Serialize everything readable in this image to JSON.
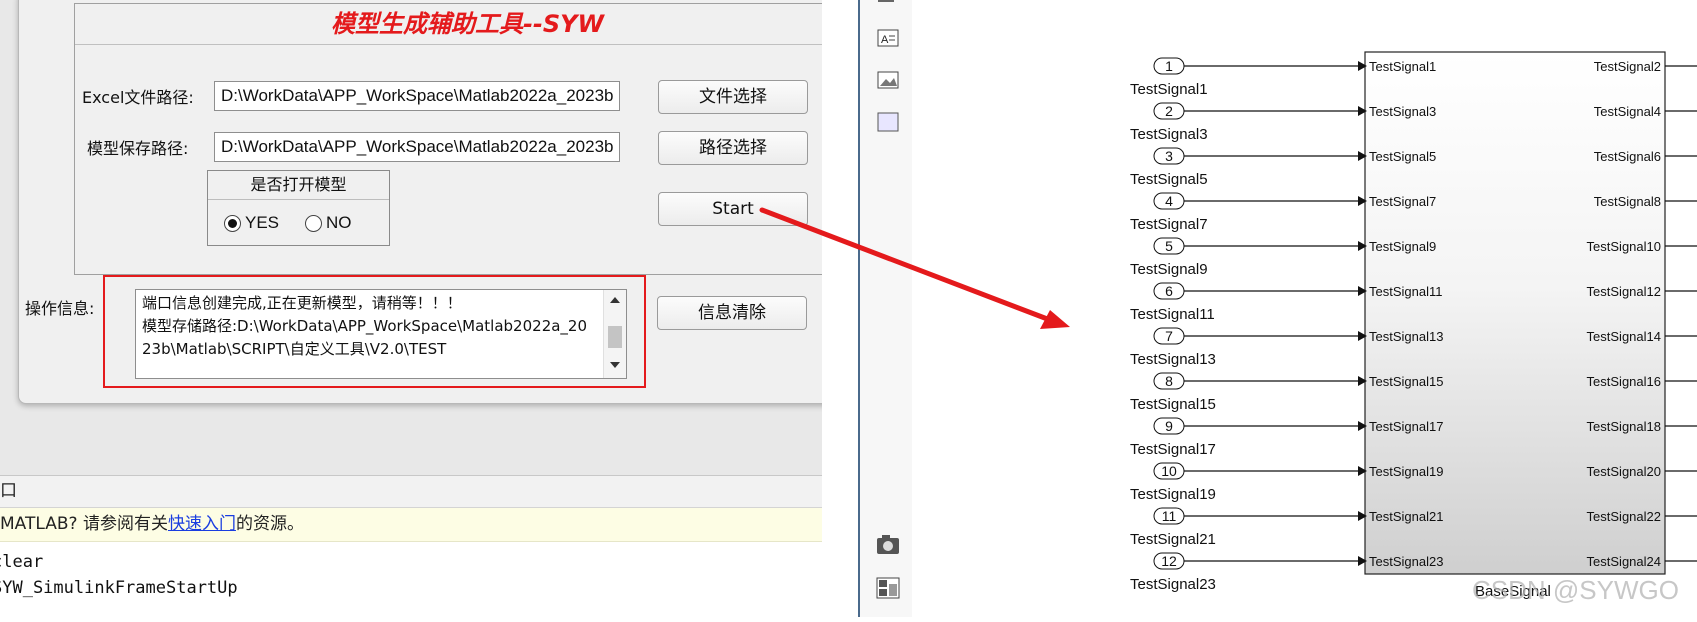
{
  "app": {
    "title": "模型生成辅助工具--SYW",
    "excel_label": "Excel文件路径:",
    "excel_path": "D:\\WorkData\\APP_WorkSpace\\Matlab2022a_2023b",
    "excel_button": "文件选择",
    "model_label": "模型保存路径:",
    "model_path": "D:\\WorkData\\APP_WorkSpace\\Matlab2022a_2023b",
    "model_button": "路径选择",
    "open_group_title": "是否打开模型",
    "radio_yes": "YES",
    "radio_no": "NO",
    "start_button": "Start",
    "info_label": "操作信息:",
    "info_text": "端口信息创建完成,正在更新模型，请稍等！！！\n模型存储路径:D:\\WorkData\\APP_WorkSpace\\Matlab2022a_2023b\\Matlab\\SCRIPT\\自定义工具\\V2.0\\TEST",
    "clear_button": "信息清除"
  },
  "command_window": {
    "header": "口",
    "tip_prefix": "MATLAB? 请参阅有关",
    "tip_link": "快速入门",
    "tip_suffix": "的资源。",
    "lines": [
      "clear",
      "SYW_SimulinkFrameStartUp"
    ]
  },
  "simulink": {
    "block_name": "BaseSignal",
    "watermark": "CSDN @SYWGO",
    "inports": [
      {
        "num": "1",
        "name": "TestSignal1"
      },
      {
        "num": "2",
        "name": "TestSignal3"
      },
      {
        "num": "3",
        "name": "TestSignal5"
      },
      {
        "num": "4",
        "name": "TestSignal7"
      },
      {
        "num": "5",
        "name": "TestSignal9"
      },
      {
        "num": "6",
        "name": "TestSignal11"
      },
      {
        "num": "7",
        "name": "TestSignal13"
      },
      {
        "num": "8",
        "name": "TestSignal15"
      },
      {
        "num": "9",
        "name": "TestSignal17"
      },
      {
        "num": "10",
        "name": "TestSignal19"
      },
      {
        "num": "11",
        "name": "TestSignal21"
      },
      {
        "num": "12",
        "name": "TestSignal23"
      }
    ],
    "outports": [
      "TestSignal2",
      "TestSignal4",
      "TestSignal6",
      "TestSignal8",
      "TestSignal10",
      "TestSignal12",
      "TestSignal14",
      "TestSignal16",
      "TestSignal18",
      "TestSignal20",
      "TestSignal22",
      "TestSignal24"
    ]
  },
  "colors": {
    "title_red": "#e41a1c",
    "highlight_red": "#e41a1c",
    "arrow_red": "#e41a1c",
    "link_blue": "#1a3de0"
  }
}
